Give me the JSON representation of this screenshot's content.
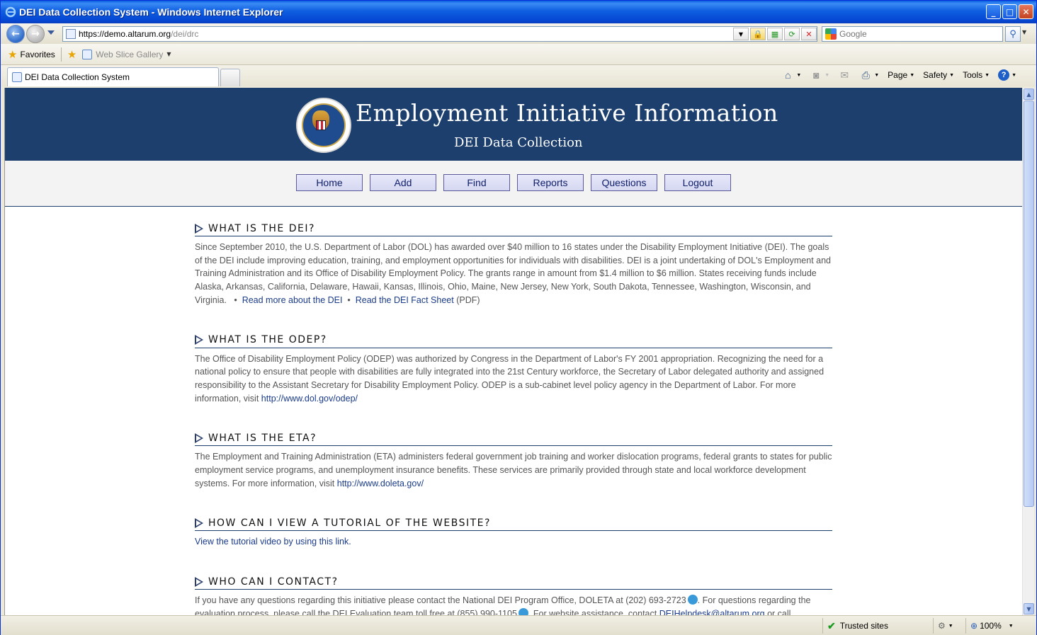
{
  "window": {
    "title": "DEI Data Collection System - Windows Internet Explorer",
    "minimize": "_",
    "maximize": "□",
    "close": "✕"
  },
  "address": {
    "url_prefix": "https://demo.",
    "url_domain": "altarum.org",
    "url_suffix": "/dei/drc"
  },
  "search": {
    "placeholder": "Google"
  },
  "favorites": {
    "label": "Favorites",
    "web_slice": "Web Slice Gallery"
  },
  "tab": {
    "label": "DEI Data Collection System"
  },
  "commandbar": {
    "page": "Page",
    "safety": "Safety",
    "tools": "Tools",
    "help": "?"
  },
  "banner": {
    "title": "Employment Initiative Information",
    "subtitle": "DEI Data Collection"
  },
  "nav": {
    "items": [
      "Home",
      "Add",
      "Find",
      "Reports",
      "Questions",
      "Logout"
    ]
  },
  "sections": [
    {
      "title": "WHAT IS THE DEI?",
      "body": "Since September 2010, the U.S. Department of Labor (DOL) has awarded over $40 million to 16 states under the Disability Employment Initiative (DEI). The goals of the DEI include improving education, training, and employment opportunities for individuals with disabilities. DEI is a joint undertaking of DOL's Employment and Training Administration and its Office of Disability Employment Policy. The grants range in amount from $1.4 million to $6 million. States receiving funds include Alaska, Arkansas, California, Delaware, Hawaii, Kansas, Illinois, Ohio, Maine, New Jersey, New York, South Dakota, Tennessee, Washington, Wisconsin, and Virginia.",
      "bullet": "•",
      "link1": "Read more about the DEI",
      "link2": "Read the DEI Fact Sheet",
      "link2_suffix": "(PDF)"
    },
    {
      "title": "WHAT IS THE ODEP?",
      "body": "The Office of Disability Employment Policy (ODEP) was authorized by Congress in the Department of Labor's FY 2001 appropriation. Recognizing the need for a national policy to ensure that people with disabilities are fully integrated into the 21st Century workforce, the Secretary of Labor delegated authority and assigned responsibility to the Assistant Secretary for Disability Employment Policy. ODEP is a sub-cabinet level policy agency in the Department of Labor. For more information, visit",
      "link": "http://www.dol.gov/odep/"
    },
    {
      "title": "WHAT IS THE ETA?",
      "body": "The Employment and Training Administration (ETA) administers federal government job training and worker dislocation programs, federal grants to states for public employment service programs, and unemployment insurance benefits. These services are primarily provided through state and local workforce development systems. For more information, visit",
      "link": "http://www.doleta.gov/"
    },
    {
      "title": "HOW CAN I VIEW A TUTORIAL OF THE WEBSITE?",
      "link": "View the tutorial video by using this link."
    },
    {
      "title": "WHO CAN I CONTACT?",
      "body1": "If you have any questions regarding this initiative please contact the National DEI Program Office, DOLETA at (202) 693-2723",
      "body2": ". For questions regarding the evaluation process, please call the DEI Evaluation team toll free at (855) 990-1105",
      "body3": ". For website assistance, contact",
      "link": "DEIHelpdesk@altarum.org",
      "body4": "or call"
    }
  ],
  "status": {
    "zone": "Trusted sites",
    "zoom": "100%"
  }
}
